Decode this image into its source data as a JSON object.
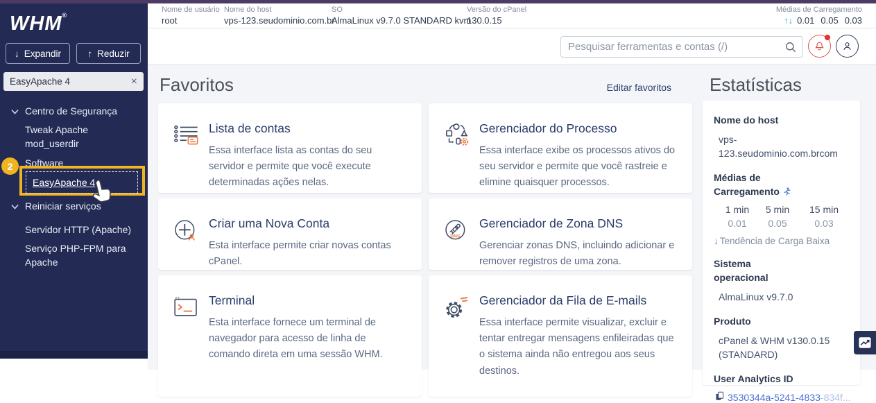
{
  "brand": {
    "logo": "WHM",
    "registered": "®"
  },
  "topbar": {
    "username_label": "Nome de usuário",
    "username_value": "root",
    "host_label": "Nome do host",
    "host_value": "vps-123.seudominio.com.br",
    "os_label": "SO",
    "os_value": "AlmaLinux v9.7.0 STANDARD kvm",
    "cpanel_label": "Versão do cPanel",
    "cpanel_value": "130.0.15",
    "load_label": "Médias de Carregamento",
    "load_arrows": "↑↓",
    "load_1": "0.01",
    "load_5": "0.05",
    "load_15": "0.03"
  },
  "sidebar": {
    "expand_arrow": "↓",
    "expand_label": "Expandir",
    "collapse_arrow": "↑",
    "collapse_label": "Reduzir",
    "search_value": "EasyApache 4",
    "clear_x": "×",
    "badge": "2",
    "items": {
      "security": "Centro de Segurança",
      "tweak": "Tweak Apache mod_userdir",
      "software": "Software",
      "easyapache": "EasyApache 4",
      "restart": "Reiniciar serviços",
      "http": "Servidor HTTP (Apache)",
      "phpfpm": "Serviço PHP-FPM para Apache"
    }
  },
  "header": {
    "search_placeholder": "Pesquisar ferramentas e contas (/)"
  },
  "favorites": {
    "title": "Favoritos",
    "edit_link": "Editar favoritos",
    "cards": [
      {
        "title": "Lista de contas",
        "desc": "Essa interface lista as contas do seu servidor e permite que você execute determinadas ações nelas."
      },
      {
        "title": "Gerenciador do Processo",
        "desc": "Essa interface exibe os processos ativos do seu servidor e permite que você rastreie e elimine quaisquer processos."
      },
      {
        "title": "Criar uma Nova Conta",
        "desc": "Esta interface permite criar novas contas cPanel."
      },
      {
        "title": "Gerenciador de Zona DNS",
        "desc": "Gerenciar zonas DNS, incluindo adicionar e remover registros de uma zona.",
        "icon_text": "DNS"
      },
      {
        "title": "Terminal",
        "desc": "Esta interface fornece um terminal de navegador para acesso de linha de comando direta em uma sessão WHM."
      },
      {
        "title": "Gerenciador da Fila de E-mails",
        "desc": "Essa interface permite visualizar, excluir e tentar entregar mensagens enfileiradas que o sistema ainda não entregou aos seus destinos."
      }
    ]
  },
  "stats": {
    "title": "Estatísticas",
    "hostname_label": "Nome do host",
    "hostname_value": "vps-123.seudominio.com.brcom",
    "load_label": "Médias de Carregamento",
    "load_cols": [
      "1 min",
      "5 min",
      "15 min"
    ],
    "load_vals": [
      "0.01",
      "0.05",
      "0.03"
    ],
    "trend_arrow": "↓",
    "trend": "Tendência de Carga Baixa",
    "os_label": "Sistema operacional",
    "os_value": "AlmaLinux v9.7.0",
    "product_label": "Produto",
    "product_value": "cPanel & WHM v130.0.15 (STANDARD)",
    "analytics_label": "User Analytics ID",
    "analytics_value": "3530344a-5241-4833",
    "analytics_value_faded": "-834f..."
  },
  "colors": {
    "highlight_yellow": "#f0b322",
    "sidebar_navy": "#232b54",
    "top_strip_purple": "#4c3b64",
    "accent_orange": "#ed7c45",
    "link_blue": "#4a6fd6",
    "bell_red": "#d9544f",
    "load_arrow_blue": "#37a6dc"
  }
}
